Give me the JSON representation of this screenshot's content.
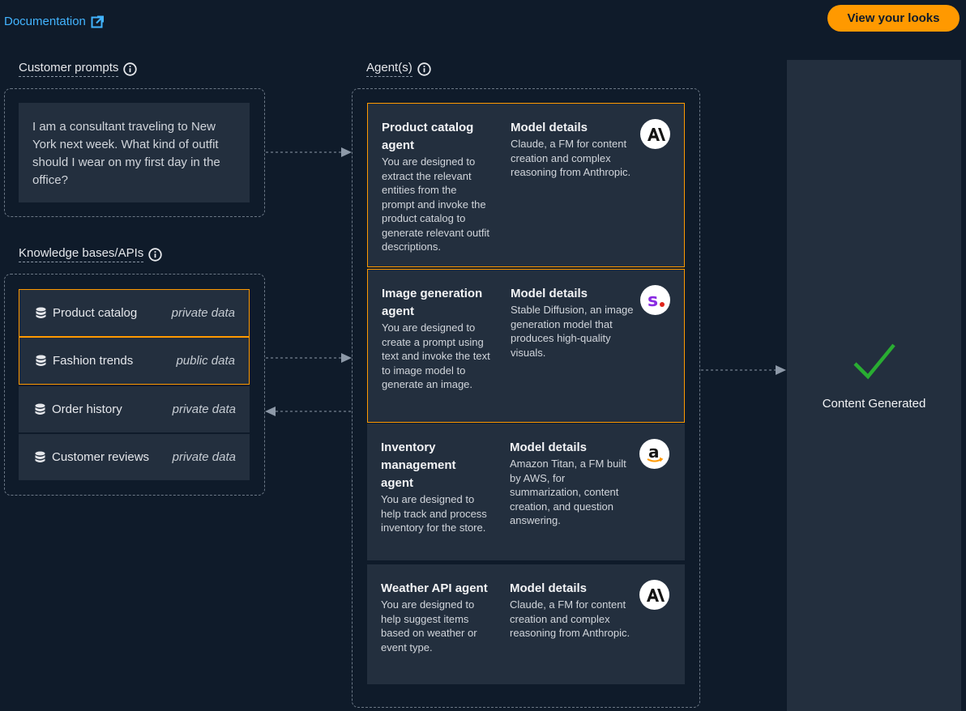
{
  "header": {
    "doc_link": "Documentation",
    "view_button": "View your looks"
  },
  "customer_prompts": {
    "label": "Customer prompts",
    "prompt": "I am a consultant traveling to New York next week. What kind of outfit should I wear on my first day in the office?"
  },
  "knowledge_bases": {
    "label": "Knowledge bases/APIs",
    "items": [
      {
        "name": "Product catalog",
        "type": "private data",
        "selected": true
      },
      {
        "name": "Fashion trends",
        "type": "public data",
        "selected": true
      },
      {
        "name": "Order history",
        "type": "private data",
        "selected": false
      },
      {
        "name": "Customer reviews",
        "type": "private data",
        "selected": false
      }
    ]
  },
  "agents": {
    "label": "Agent(s)",
    "items": [
      {
        "title": "Product catalog agent",
        "description": "You are designed to extract the relevant entities from the prompt and invoke the product catalog to generate relevant outfit descriptions.",
        "model_title": "Model details",
        "model_description": "Claude, a FM for content creation and complex reasoning from Anthropic.",
        "logo": "anthropic-icon",
        "selected": true
      },
      {
        "title": "Image generation agent",
        "description": "You are designed to create a prompt using text and invoke the text to image model to generate an image.",
        "model_title": "Model details",
        "model_description": "Stable Diffusion, an image generation model that produces high-quality visuals.",
        "logo": "stability-icon",
        "selected": true
      },
      {
        "title": "Inventory management agent",
        "description": "You are designed to help track and process inventory for the store.",
        "model_title": "Model details",
        "model_description": "Amazon Titan, a FM built by AWS, for summarization, content creation, and question answering.",
        "logo": "amazon-icon",
        "selected": false
      },
      {
        "title": "Weather API agent",
        "description": "You are designed to help suggest items based on weather or event type.",
        "model_title": "Model details",
        "model_description": "Claude, a FM for content creation and complex reasoning from Anthropic.",
        "logo": "anthropic-icon",
        "selected": false
      }
    ]
  },
  "result": {
    "status": "Content Generated"
  },
  "colors": {
    "background": "#0f1b2a",
    "card": "#232f3e",
    "accent": "#ff9900",
    "link": "#42b4ff",
    "success": "#29ad32"
  }
}
